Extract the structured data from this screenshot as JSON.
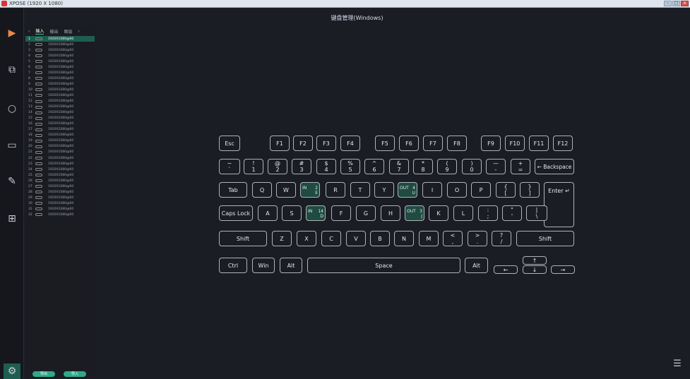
{
  "app": {
    "title": "XPOSE (1920 X 1080)"
  },
  "header": {
    "title": "键盘管理(Windows)"
  },
  "tabs": [
    "输入",
    "输出",
    "图层"
  ],
  "rows": [
    {
      "n": "1",
      "res": "1920X1080@60",
      "sel": true
    },
    {
      "n": "2",
      "res": "1920X1080@60"
    },
    {
      "n": "3",
      "res": "1920X1080@60"
    },
    {
      "n": "4",
      "res": "1920X1080@60"
    },
    {
      "n": "5",
      "res": "1920X1080@60"
    },
    {
      "n": "6",
      "res": "1920X1080@60"
    },
    {
      "n": "7",
      "res": "1920X1080@60"
    },
    {
      "n": "8",
      "res": "1920X1080@60"
    },
    {
      "n": "9",
      "res": "1920X1080@60"
    },
    {
      "n": "10",
      "res": "1920X1080@60"
    },
    {
      "n": "11",
      "res": "1920X1080@60"
    },
    {
      "n": "12",
      "res": "1920X1080@60"
    },
    {
      "n": "13",
      "res": "1920X1080@60"
    },
    {
      "n": "14",
      "res": "1920X1080@60"
    },
    {
      "n": "15",
      "res": "1920X1080@60"
    },
    {
      "n": "16",
      "res": "1920X1080@60"
    },
    {
      "n": "17",
      "res": "1920X1080@60"
    },
    {
      "n": "18",
      "res": "1920X1080@60"
    },
    {
      "n": "19",
      "res": "1920X1080@60"
    },
    {
      "n": "20",
      "res": "1920X1080@60"
    },
    {
      "n": "21",
      "res": "1920X1080@60"
    },
    {
      "n": "22",
      "res": "1920X1080@60"
    },
    {
      "n": "23",
      "res": "1920X1080@60"
    },
    {
      "n": "24",
      "res": "1920X1080@60"
    },
    {
      "n": "25",
      "res": "1920X1080@60"
    },
    {
      "n": "26",
      "res": "1920X1080@60"
    },
    {
      "n": "27",
      "res": "1920X1080@60"
    },
    {
      "n": "28",
      "res": "1920X1080@60"
    },
    {
      "n": "29",
      "res": "1920X1080@60"
    },
    {
      "n": "30",
      "res": "1920X1080@60"
    },
    {
      "n": "31",
      "res": "1920X1080@60"
    },
    {
      "n": "32",
      "res": "1920X1080@60"
    }
  ],
  "buttons": {
    "export": "导出",
    "import": "导入"
  },
  "keys": {
    "esc": "Esc",
    "f1": "F1",
    "f2": "F2",
    "f3": "F3",
    "f4": "F4",
    "f5": "F5",
    "f6": "F6",
    "f7": "F7",
    "f8": "F8",
    "f9": "F9",
    "f10": "F10",
    "f11": "F11",
    "f12": "F12",
    "tilde": "~\n`",
    "k1": "!\n1",
    "k2": "@\n2",
    "k3": "#\n3",
    "k4": "$\n4",
    "k5": "%\n5",
    "k6": "^\n6",
    "k7": "&\n7",
    "k8": "*\n8",
    "k9": "(\n9",
    "k0": ")\n0",
    "minus": "—\n-",
    "plus": "+\n=",
    "backspace": "← Backspace",
    "tab": "Tab",
    "q": "Q",
    "w": "W",
    "e_in": "IN",
    "e_num": "2",
    "e_letter": "E",
    "r": "R",
    "t": "T",
    "y": "Y",
    "u_out": "OUT",
    "u_num": "4",
    "u_letter": "U",
    "i": "I",
    "o": "O",
    "p": "P",
    "lbracket": "{\n[",
    "rbracket": "}\n]",
    "enter": "Enter ↵",
    "caps": "Caps Lock",
    "a": "A",
    "s": "S",
    "d_in": "IN",
    "d_num": "14",
    "d_letter": "D",
    "f": "F",
    "g": "G",
    "h": "H",
    "j_out": "OUT",
    "j_num": "3",
    "j_letter": "J",
    "k": "K",
    "l": "L",
    "semicolon": ":\n;",
    "quote": "\"\n'",
    "backslash": "|\n\\",
    "shift_l": "Shift",
    "z": "Z",
    "x": "X",
    "c": "C",
    "v": "V",
    "b": "B",
    "n": "N",
    "m": "M",
    "comma": "<\n,",
    "period": ">\n.",
    "slash": "?\n/",
    "shift_r": "Shift",
    "ctrl": "Ctrl",
    "win": "Win",
    "alt_l": "Alt",
    "space": "Space",
    "alt_r": "Alt",
    "left": "←",
    "up": "↑",
    "down": "↓",
    "right": "→"
  }
}
